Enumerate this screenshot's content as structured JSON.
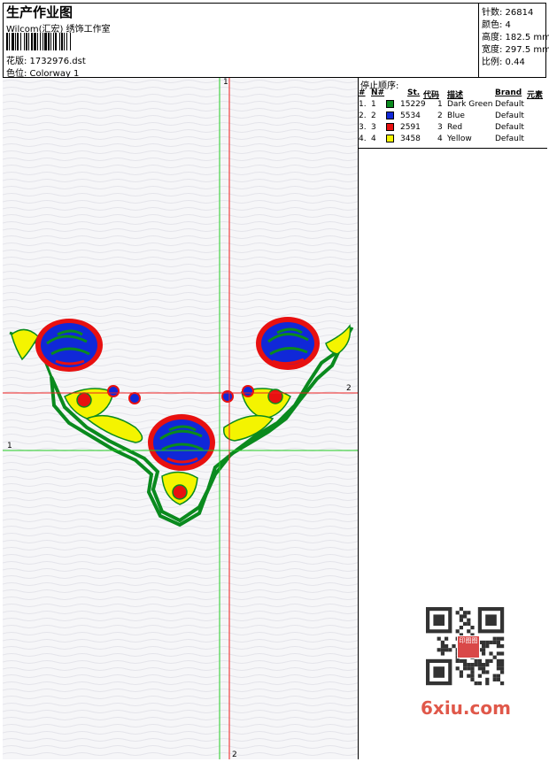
{
  "header": {
    "title": "生产作业图",
    "subtitle": "Wilcom(汇宏) 绣饰工作室",
    "design_label": "花版: 1732976.dst",
    "colorway_label": "色位: Colorway 1"
  },
  "specs": {
    "stitches": "针数: 26814",
    "colors": "颜色: 4",
    "height": "高度: 182.5 mm",
    "width": "宽度: 297.5 mm",
    "scale": "比例: 0.44"
  },
  "stop_sequence": {
    "label": "停止顺序:",
    "columns": [
      "#",
      "N#",
      "St.",
      "代码",
      "描述",
      "Brand",
      "元素"
    ],
    "rows": [
      {
        "idx": "1.",
        "n": "1",
        "st": "15229",
        "code": "1",
        "desc": "Dark Green",
        "brand": "Default",
        "color": "#0a8a1e"
      },
      {
        "idx": "2.",
        "n": "2",
        "st": "5534",
        "code": "2",
        "desc": "Blue",
        "brand": "Default",
        "color": "#1028d8"
      },
      {
        "idx": "3.",
        "n": "3",
        "st": "2591",
        "code": "3",
        "desc": "Red",
        "brand": "Default",
        "color": "#e81010"
      },
      {
        "idx": "4.",
        "n": "4",
        "st": "3458",
        "code": "4",
        "desc": "Yellow",
        "brand": "Default",
        "color": "#f4f400"
      }
    ]
  },
  "axes": {
    "green_vertical_top": "1",
    "red_vertical_bottom": "2",
    "red_horizontal_right": "2",
    "green_horizontal_left": "1"
  },
  "watermark": {
    "text": "6xiu.com",
    "seal_text": "印图图"
  },
  "colors": {
    "dark_green": "#0a8a1e",
    "blue": "#1028d8",
    "red": "#e81010",
    "yellow": "#f4f400",
    "guide_green": "#22cc22",
    "guide_red": "#ee2020"
  }
}
